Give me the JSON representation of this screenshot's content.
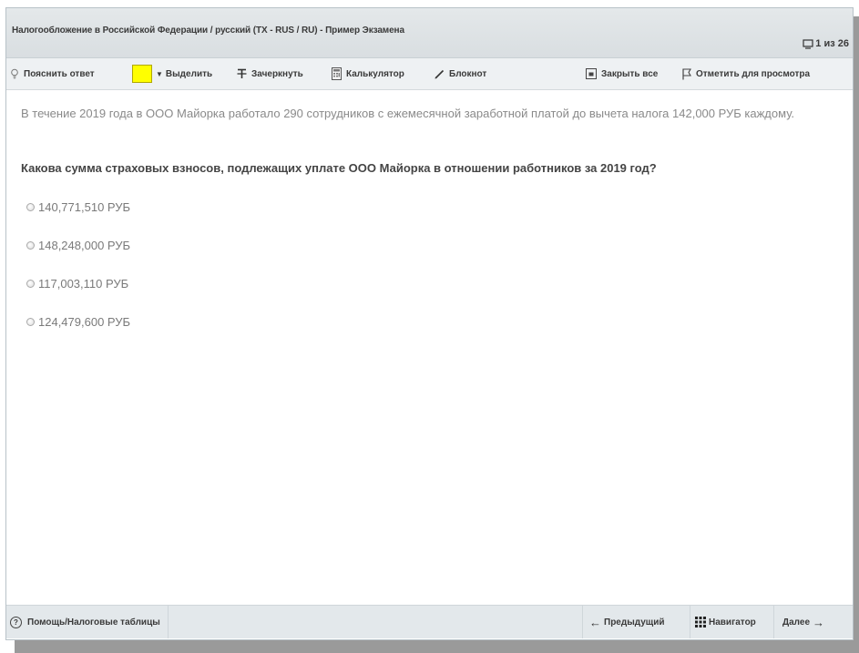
{
  "window": {
    "title": "Налогообложение в Российской Федерации / русский (TX - RUS / RU) - Пример Экзамена",
    "page_counter": "1 из 26"
  },
  "toolbar": {
    "explain": "Пояснить ответ",
    "highlight": "Выделить",
    "strikethrough": "Зачеркнуть",
    "calculator": "Калькулятор",
    "notepad": "Блокнот",
    "close_all": "Закрыть все",
    "flag_for_review": "Отметить для просмотра",
    "highlight_color": "#ffff00"
  },
  "question": {
    "intro": "В течение 2019 года в ООО Майорка работало 290 сотрудников с ежемесячной заработной платой до вычета налога 142,000 РУБ каждому.",
    "prompt": "Какова сумма страховых взносов, подлежащих уплате ООО Майорка в отношении  работников за 2019 год?",
    "options": [
      {
        "label": "140,771,510 РУБ"
      },
      {
        "label": "148,248,000 РУБ"
      },
      {
        "label": "117,003,110 РУБ"
      },
      {
        "label": "124,479,600 РУБ"
      }
    ]
  },
  "footer": {
    "help": "Помощь/Налоговые таблицы",
    "previous": "Предыдущий",
    "navigator": "Навигатор",
    "next": "Далее"
  }
}
